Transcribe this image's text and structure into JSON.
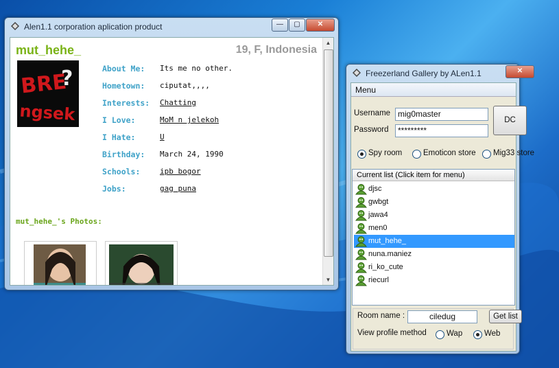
{
  "profile_window": {
    "title": "Alen1.1 corporation aplication product",
    "username": "mut_hehe_",
    "summary": "19, F, Indonesia",
    "fields": [
      {
        "label": "About Me:",
        "value": "Its me no other.",
        "link": false
      },
      {
        "label": "Hometown:",
        "value": "ciputat,,,,",
        "link": false
      },
      {
        "label": "Interests:",
        "value": "Chatting",
        "link": true
      },
      {
        "label": "I Love:",
        "value": "MoM n jelekoh",
        "link": true
      },
      {
        "label": "I Hate:",
        "value": "U",
        "link": true
      },
      {
        "label": "Birthday:",
        "value": "March 24, 1990",
        "link": false
      },
      {
        "label": "Schools:",
        "value": "ipb bogor",
        "link": true
      },
      {
        "label": "Jobs:",
        "value": "gag puna",
        "link": true
      }
    ],
    "photos_title": "mut_hehe_'s Photos:",
    "avatar_text": "BRE? ngsek"
  },
  "gallery_window": {
    "title": "Freezerland Gallery by ALen1.1",
    "menu_label": "Menu",
    "username_label": "Username",
    "username_value": "mig0master",
    "password_label": "Password",
    "password_value": "*********",
    "dc_label": "DC",
    "modes": [
      {
        "label": "Spy room",
        "selected": true
      },
      {
        "label": "Emoticon store",
        "selected": false
      },
      {
        "label": "Mig33 store",
        "selected": false
      }
    ],
    "list_header": "Current list (Click item for menu)",
    "users": [
      {
        "name": "djsc",
        "selected": false
      },
      {
        "name": "gwbgt",
        "selected": false
      },
      {
        "name": "jawa4",
        "selected": false
      },
      {
        "name": "men0",
        "selected": false
      },
      {
        "name": "mut_hehe_",
        "selected": true
      },
      {
        "name": "nuna.maniez",
        "selected": false
      },
      {
        "name": "ri_ko_cute",
        "selected": false
      },
      {
        "name": "riecurl",
        "selected": false
      }
    ],
    "room_label": "Room name :",
    "room_value": "ciledug",
    "get_list_label": "Get list",
    "view_method_label": "View profile method",
    "view_methods": [
      {
        "label": "Wap",
        "selected": false
      },
      {
        "label": "Web",
        "selected": true
      }
    ]
  },
  "colors": {
    "accent_green": "#7ab317",
    "label_blue": "#3fa2c8",
    "selection": "#3399ff"
  }
}
